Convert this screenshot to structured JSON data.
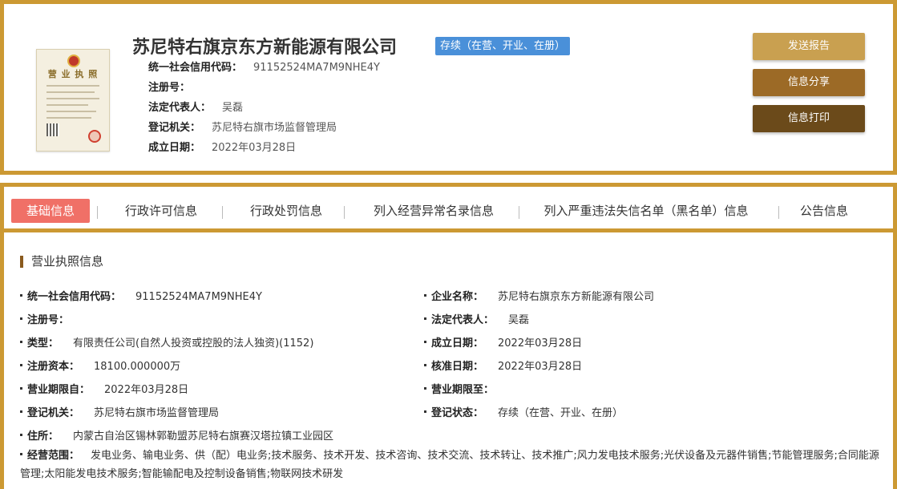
{
  "header": {
    "company_name": "苏尼特右旗京东方新能源有限公司",
    "status_badge": "存续（在营、开业、在册）",
    "license_thumb_title": "营 业 执 照",
    "fields": [
      {
        "label": "统一社会信用代码：",
        "value": "91152524MA7M9NHE4Y"
      },
      {
        "label": "注册号：",
        "value": ""
      },
      {
        "label": "法定代表人：",
        "value": "吴磊"
      },
      {
        "label": "登记机关：",
        "value": "苏尼特右旗市场监督管理局"
      },
      {
        "label": "成立日期：",
        "value": "2022年03月28日"
      }
    ],
    "buttons": {
      "send_report": "发送报告",
      "share_info": "信息分享",
      "print_info": "信息打印"
    },
    "colors": {
      "border": "#cc9933",
      "badge": "#4a90d9",
      "btn_send": "#c9a050",
      "btn_share": "#9c6a26",
      "btn_print": "#6b4a1a"
    }
  },
  "tabs": [
    {
      "label": "基础信息",
      "active": true
    },
    {
      "label": "行政许可信息",
      "active": false
    },
    {
      "label": "行政处罚信息",
      "active": false
    },
    {
      "label": "列入经营异常名录信息",
      "active": false
    },
    {
      "label": "列入严重违法失信名单（黑名单）信息",
      "active": false
    },
    {
      "label": "公告信息",
      "active": false
    }
  ],
  "section": {
    "title": "营业执照信息",
    "left": [
      {
        "label": "统一社会信用代码：",
        "value": "91152524MA7M9NHE4Y"
      },
      {
        "label": "注册号：",
        "value": ""
      },
      {
        "label": "类型：",
        "value": "有限责任公司(自然人投资或控股的法人独资)(1152)"
      },
      {
        "label": "注册资本：",
        "value": "18100.000000万"
      },
      {
        "label": "营业期限自：",
        "value": "2022年03月28日"
      },
      {
        "label": "登记机关：",
        "value": "苏尼特右旗市场监督管理局"
      },
      {
        "label": "住所：",
        "value": "内蒙古自治区锡林郭勒盟苏尼特右旗赛汉塔拉镇工业园区"
      }
    ],
    "right": [
      {
        "label": "企业名称：",
        "value": "苏尼特右旗京东方新能源有限公司"
      },
      {
        "label": "法定代表人：",
        "value": "吴磊"
      },
      {
        "label": "成立日期：",
        "value": "2022年03月28日"
      },
      {
        "label": "核准日期：",
        "value": "2022年03月28日"
      },
      {
        "label": "营业期限至：",
        "value": ""
      },
      {
        "label": "登记状态：",
        "value": "存续（在营、开业、在册）"
      }
    ],
    "scope": {
      "label": "经营范围：",
      "value": "发电业务、输电业务、供（配）电业务;技术服务、技术开发、技术咨询、技术交流、技术转让、技术推广;风力发电技术服务;光伏设备及元器件销售;节能管理服务;合同能源管理;太阳能发电技术服务;智能输配电及控制设备销售;物联网技术研发"
    }
  }
}
